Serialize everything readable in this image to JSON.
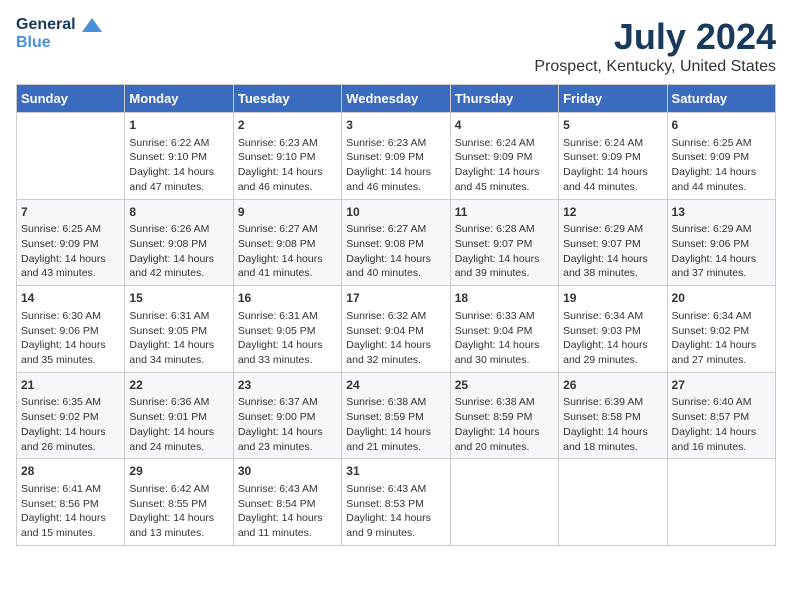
{
  "logo": {
    "line1": "General",
    "line2": "Blue"
  },
  "title": "July 2024",
  "subtitle": "Prospect, Kentucky, United States",
  "days_of_week": [
    "Sunday",
    "Monday",
    "Tuesday",
    "Wednesday",
    "Thursday",
    "Friday",
    "Saturday"
  ],
  "weeks": [
    [
      {
        "day": "",
        "content": ""
      },
      {
        "day": "1",
        "content": "Sunrise: 6:22 AM\nSunset: 9:10 PM\nDaylight: 14 hours\nand 47 minutes."
      },
      {
        "day": "2",
        "content": "Sunrise: 6:23 AM\nSunset: 9:10 PM\nDaylight: 14 hours\nand 46 minutes."
      },
      {
        "day": "3",
        "content": "Sunrise: 6:23 AM\nSunset: 9:09 PM\nDaylight: 14 hours\nand 46 minutes."
      },
      {
        "day": "4",
        "content": "Sunrise: 6:24 AM\nSunset: 9:09 PM\nDaylight: 14 hours\nand 45 minutes."
      },
      {
        "day": "5",
        "content": "Sunrise: 6:24 AM\nSunset: 9:09 PM\nDaylight: 14 hours\nand 44 minutes."
      },
      {
        "day": "6",
        "content": "Sunrise: 6:25 AM\nSunset: 9:09 PM\nDaylight: 14 hours\nand 44 minutes."
      }
    ],
    [
      {
        "day": "7",
        "content": "Sunrise: 6:25 AM\nSunset: 9:09 PM\nDaylight: 14 hours\nand 43 minutes."
      },
      {
        "day": "8",
        "content": "Sunrise: 6:26 AM\nSunset: 9:08 PM\nDaylight: 14 hours\nand 42 minutes."
      },
      {
        "day": "9",
        "content": "Sunrise: 6:27 AM\nSunset: 9:08 PM\nDaylight: 14 hours\nand 41 minutes."
      },
      {
        "day": "10",
        "content": "Sunrise: 6:27 AM\nSunset: 9:08 PM\nDaylight: 14 hours\nand 40 minutes."
      },
      {
        "day": "11",
        "content": "Sunrise: 6:28 AM\nSunset: 9:07 PM\nDaylight: 14 hours\nand 39 minutes."
      },
      {
        "day": "12",
        "content": "Sunrise: 6:29 AM\nSunset: 9:07 PM\nDaylight: 14 hours\nand 38 minutes."
      },
      {
        "day": "13",
        "content": "Sunrise: 6:29 AM\nSunset: 9:06 PM\nDaylight: 14 hours\nand 37 minutes."
      }
    ],
    [
      {
        "day": "14",
        "content": "Sunrise: 6:30 AM\nSunset: 9:06 PM\nDaylight: 14 hours\nand 35 minutes."
      },
      {
        "day": "15",
        "content": "Sunrise: 6:31 AM\nSunset: 9:05 PM\nDaylight: 14 hours\nand 34 minutes."
      },
      {
        "day": "16",
        "content": "Sunrise: 6:31 AM\nSunset: 9:05 PM\nDaylight: 14 hours\nand 33 minutes."
      },
      {
        "day": "17",
        "content": "Sunrise: 6:32 AM\nSunset: 9:04 PM\nDaylight: 14 hours\nand 32 minutes."
      },
      {
        "day": "18",
        "content": "Sunrise: 6:33 AM\nSunset: 9:04 PM\nDaylight: 14 hours\nand 30 minutes."
      },
      {
        "day": "19",
        "content": "Sunrise: 6:34 AM\nSunset: 9:03 PM\nDaylight: 14 hours\nand 29 minutes."
      },
      {
        "day": "20",
        "content": "Sunrise: 6:34 AM\nSunset: 9:02 PM\nDaylight: 14 hours\nand 27 minutes."
      }
    ],
    [
      {
        "day": "21",
        "content": "Sunrise: 6:35 AM\nSunset: 9:02 PM\nDaylight: 14 hours\nand 26 minutes."
      },
      {
        "day": "22",
        "content": "Sunrise: 6:36 AM\nSunset: 9:01 PM\nDaylight: 14 hours\nand 24 minutes."
      },
      {
        "day": "23",
        "content": "Sunrise: 6:37 AM\nSunset: 9:00 PM\nDaylight: 14 hours\nand 23 minutes."
      },
      {
        "day": "24",
        "content": "Sunrise: 6:38 AM\nSunset: 8:59 PM\nDaylight: 14 hours\nand 21 minutes."
      },
      {
        "day": "25",
        "content": "Sunrise: 6:38 AM\nSunset: 8:59 PM\nDaylight: 14 hours\nand 20 minutes."
      },
      {
        "day": "26",
        "content": "Sunrise: 6:39 AM\nSunset: 8:58 PM\nDaylight: 14 hours\nand 18 minutes."
      },
      {
        "day": "27",
        "content": "Sunrise: 6:40 AM\nSunset: 8:57 PM\nDaylight: 14 hours\nand 16 minutes."
      }
    ],
    [
      {
        "day": "28",
        "content": "Sunrise: 6:41 AM\nSunset: 8:56 PM\nDaylight: 14 hours\nand 15 minutes."
      },
      {
        "day": "29",
        "content": "Sunrise: 6:42 AM\nSunset: 8:55 PM\nDaylight: 14 hours\nand 13 minutes."
      },
      {
        "day": "30",
        "content": "Sunrise: 6:43 AM\nSunset: 8:54 PM\nDaylight: 14 hours\nand 11 minutes."
      },
      {
        "day": "31",
        "content": "Sunrise: 6:43 AM\nSunset: 8:53 PM\nDaylight: 14 hours\nand 9 minutes."
      },
      {
        "day": "",
        "content": ""
      },
      {
        "day": "",
        "content": ""
      },
      {
        "day": "",
        "content": ""
      }
    ]
  ]
}
